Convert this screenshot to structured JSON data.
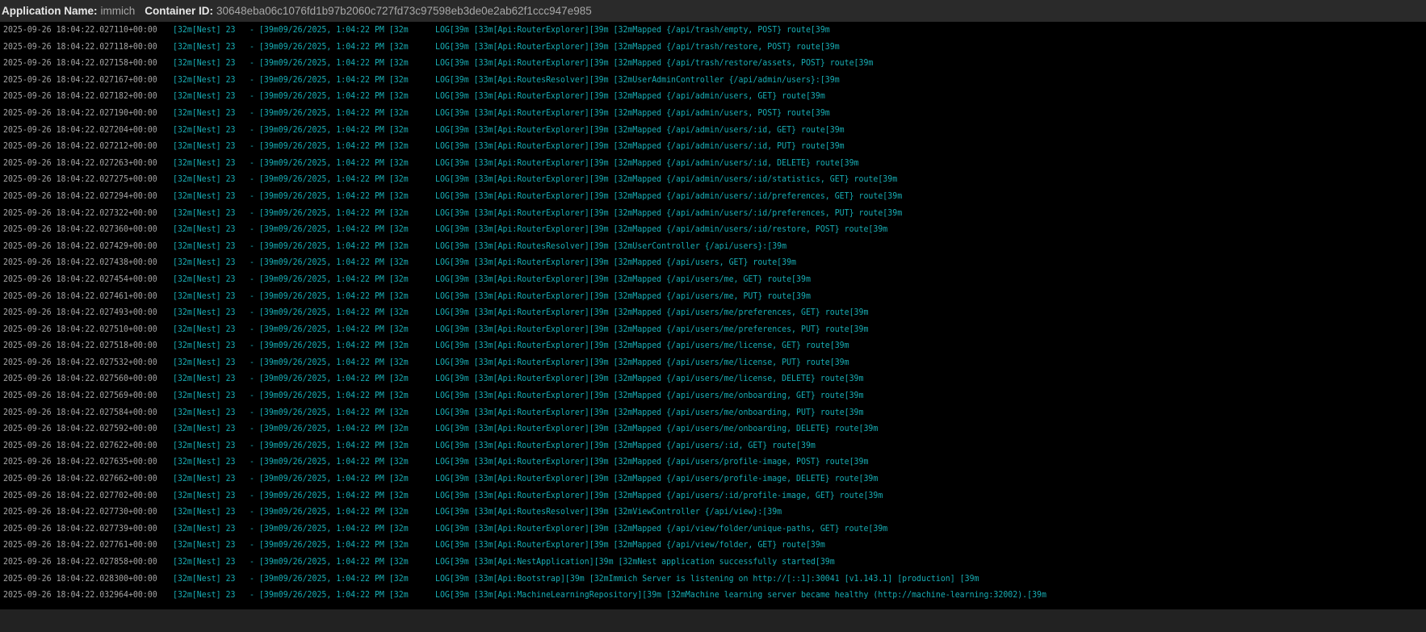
{
  "header": {
    "app_name_label": "Application Name:",
    "app_name": "immich",
    "container_id_label": "Container ID:",
    "container_id": "30648eba06c1076fd1b97b2060c727fd73c97598eb3de0e2ab62f1ccc947e985"
  },
  "colors": {
    "timestamp": "#a4a4a4",
    "log_text": "#17aeb5",
    "header_bg": "#2a2a2a"
  },
  "log": {
    "context": "[32m[Nest] 23",
    "datetime": "- [39m09/26/2025, 1:04:22 PM [32m",
    "lines": [
      {
        "ts": "2025-09-26 18:04:22.027110+00:00",
        "msg": "LOG[39m [33m[Api:RouterExplorer][39m [32mMapped {/api/trash/empty, POST} route[39m"
      },
      {
        "ts": "2025-09-26 18:04:22.027118+00:00",
        "msg": "LOG[39m [33m[Api:RouterExplorer][39m [32mMapped {/api/trash/restore, POST} route[39m"
      },
      {
        "ts": "2025-09-26 18:04:22.027158+00:00",
        "msg": "LOG[39m [33m[Api:RouterExplorer][39m [32mMapped {/api/trash/restore/assets, POST} route[39m"
      },
      {
        "ts": "2025-09-26 18:04:22.027167+00:00",
        "msg": "LOG[39m [33m[Api:RoutesResolver][39m [32mUserAdminController {/api/admin/users}:[39m"
      },
      {
        "ts": "2025-09-26 18:04:22.027182+00:00",
        "msg": "LOG[39m [33m[Api:RouterExplorer][39m [32mMapped {/api/admin/users, GET} route[39m"
      },
      {
        "ts": "2025-09-26 18:04:22.027190+00:00",
        "msg": "LOG[39m [33m[Api:RouterExplorer][39m [32mMapped {/api/admin/users, POST} route[39m"
      },
      {
        "ts": "2025-09-26 18:04:22.027204+00:00",
        "msg": "LOG[39m [33m[Api:RouterExplorer][39m [32mMapped {/api/admin/users/:id, GET} route[39m"
      },
      {
        "ts": "2025-09-26 18:04:22.027212+00:00",
        "msg": "LOG[39m [33m[Api:RouterExplorer][39m [32mMapped {/api/admin/users/:id, PUT} route[39m"
      },
      {
        "ts": "2025-09-26 18:04:22.027263+00:00",
        "msg": "LOG[39m [33m[Api:RouterExplorer][39m [32mMapped {/api/admin/users/:id, DELETE} route[39m"
      },
      {
        "ts": "2025-09-26 18:04:22.027275+00:00",
        "msg": "LOG[39m [33m[Api:RouterExplorer][39m [32mMapped {/api/admin/users/:id/statistics, GET} route[39m"
      },
      {
        "ts": "2025-09-26 18:04:22.027294+00:00",
        "msg": "LOG[39m [33m[Api:RouterExplorer][39m [32mMapped {/api/admin/users/:id/preferences, GET} route[39m"
      },
      {
        "ts": "2025-09-26 18:04:22.027322+00:00",
        "msg": "LOG[39m [33m[Api:RouterExplorer][39m [32mMapped {/api/admin/users/:id/preferences, PUT} route[39m"
      },
      {
        "ts": "2025-09-26 18:04:22.027360+00:00",
        "msg": "LOG[39m [33m[Api:RouterExplorer][39m [32mMapped {/api/admin/users/:id/restore, POST} route[39m"
      },
      {
        "ts": "2025-09-26 18:04:22.027429+00:00",
        "msg": "LOG[39m [33m[Api:RoutesResolver][39m [32mUserController {/api/users}:[39m"
      },
      {
        "ts": "2025-09-26 18:04:22.027438+00:00",
        "msg": "LOG[39m [33m[Api:RouterExplorer][39m [32mMapped {/api/users, GET} route[39m"
      },
      {
        "ts": "2025-09-26 18:04:22.027454+00:00",
        "msg": "LOG[39m [33m[Api:RouterExplorer][39m [32mMapped {/api/users/me, GET} route[39m"
      },
      {
        "ts": "2025-09-26 18:04:22.027461+00:00",
        "msg": "LOG[39m [33m[Api:RouterExplorer][39m [32mMapped {/api/users/me, PUT} route[39m"
      },
      {
        "ts": "2025-09-26 18:04:22.027493+00:00",
        "msg": "LOG[39m [33m[Api:RouterExplorer][39m [32mMapped {/api/users/me/preferences, GET} route[39m"
      },
      {
        "ts": "2025-09-26 18:04:22.027510+00:00",
        "msg": "LOG[39m [33m[Api:RouterExplorer][39m [32mMapped {/api/users/me/preferences, PUT} route[39m"
      },
      {
        "ts": "2025-09-26 18:04:22.027518+00:00",
        "msg": "LOG[39m [33m[Api:RouterExplorer][39m [32mMapped {/api/users/me/license, GET} route[39m"
      },
      {
        "ts": "2025-09-26 18:04:22.027532+00:00",
        "msg": "LOG[39m [33m[Api:RouterExplorer][39m [32mMapped {/api/users/me/license, PUT} route[39m"
      },
      {
        "ts": "2025-09-26 18:04:22.027560+00:00",
        "msg": "LOG[39m [33m[Api:RouterExplorer][39m [32mMapped {/api/users/me/license, DELETE} route[39m"
      },
      {
        "ts": "2025-09-26 18:04:22.027569+00:00",
        "msg": "LOG[39m [33m[Api:RouterExplorer][39m [32mMapped {/api/users/me/onboarding, GET} route[39m"
      },
      {
        "ts": "2025-09-26 18:04:22.027584+00:00",
        "msg": "LOG[39m [33m[Api:RouterExplorer][39m [32mMapped {/api/users/me/onboarding, PUT} route[39m"
      },
      {
        "ts": "2025-09-26 18:04:22.027592+00:00",
        "msg": "LOG[39m [33m[Api:RouterExplorer][39m [32mMapped {/api/users/me/onboarding, DELETE} route[39m"
      },
      {
        "ts": "2025-09-26 18:04:22.027622+00:00",
        "msg": "LOG[39m [33m[Api:RouterExplorer][39m [32mMapped {/api/users/:id, GET} route[39m"
      },
      {
        "ts": "2025-09-26 18:04:22.027635+00:00",
        "msg": "LOG[39m [33m[Api:RouterExplorer][39m [32mMapped {/api/users/profile-image, POST} route[39m"
      },
      {
        "ts": "2025-09-26 18:04:22.027662+00:00",
        "msg": "LOG[39m [33m[Api:RouterExplorer][39m [32mMapped {/api/users/profile-image, DELETE} route[39m"
      },
      {
        "ts": "2025-09-26 18:04:22.027702+00:00",
        "msg": "LOG[39m [33m[Api:RouterExplorer][39m [32mMapped {/api/users/:id/profile-image, GET} route[39m"
      },
      {
        "ts": "2025-09-26 18:04:22.027730+00:00",
        "msg": "LOG[39m [33m[Api:RoutesResolver][39m [32mViewController {/api/view}:[39m"
      },
      {
        "ts": "2025-09-26 18:04:22.027739+00:00",
        "msg": "LOG[39m [33m[Api:RouterExplorer][39m [32mMapped {/api/view/folder/unique-paths, GET} route[39m"
      },
      {
        "ts": "2025-09-26 18:04:22.027761+00:00",
        "msg": "LOG[39m [33m[Api:RouterExplorer][39m [32mMapped {/api/view/folder, GET} route[39m"
      },
      {
        "ts": "2025-09-26 18:04:22.027858+00:00",
        "msg": "LOG[39m [33m[Api:NestApplication][39m [32mNest application successfully started[39m"
      },
      {
        "ts": "2025-09-26 18:04:22.028300+00:00",
        "msg": "LOG[39m [33m[Api:Bootstrap][39m [32mImmich Server is listening on http://[::1]:30041 [v1.143.1] [production] [39m"
      },
      {
        "ts": "2025-09-26 18:04:22.032964+00:00",
        "msg": "LOG[39m [33m[Api:MachineLearningRepository][39m [32mMachine learning server became healthy (http://machine-learning:32002).[39m"
      }
    ]
  }
}
